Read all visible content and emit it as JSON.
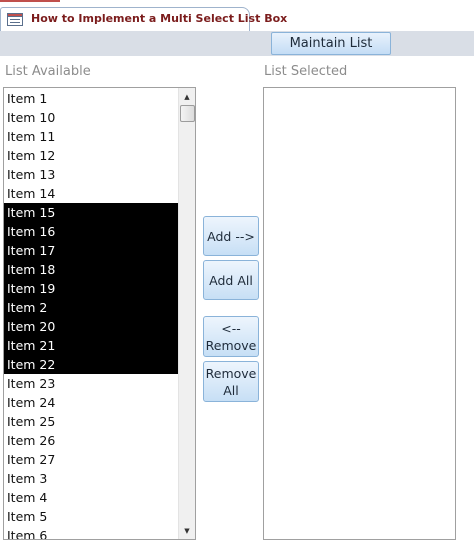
{
  "document": {
    "tab_title": "How to Implement a Multi Select List Box",
    "tab_icon": "form-icon"
  },
  "header": {
    "maintain_label": "Maintain List"
  },
  "available_list": {
    "label": "List Available",
    "items": [
      {
        "text": "Item 1",
        "selected": false
      },
      {
        "text": "Item 10",
        "selected": false
      },
      {
        "text": "Item 11",
        "selected": false
      },
      {
        "text": "Item 12",
        "selected": false
      },
      {
        "text": "Item 13",
        "selected": false
      },
      {
        "text": "Item 14",
        "selected": false
      },
      {
        "text": "Item 15",
        "selected": true
      },
      {
        "text": "Item 16",
        "selected": true
      },
      {
        "text": "Item 17",
        "selected": true
      },
      {
        "text": "Item 18",
        "selected": true
      },
      {
        "text": "Item 19",
        "selected": true
      },
      {
        "text": "Item 2",
        "selected": true
      },
      {
        "text": "Item 20",
        "selected": true
      },
      {
        "text": "Item 21",
        "selected": true
      },
      {
        "text": "Item 22",
        "selected": true
      },
      {
        "text": "Item 23",
        "selected": false
      },
      {
        "text": "Item 24",
        "selected": false
      },
      {
        "text": "Item 25",
        "selected": false
      },
      {
        "text": "Item 26",
        "selected": false
      },
      {
        "text": "Item 27",
        "selected": false
      },
      {
        "text": "Item 3",
        "selected": false
      },
      {
        "text": "Item 4",
        "selected": false
      },
      {
        "text": "Item 5",
        "selected": false
      },
      {
        "text": "Item 6",
        "selected": false
      }
    ],
    "scroll_up_glyph": "▲",
    "scroll_down_glyph": "▼"
  },
  "selected_list": {
    "label": "List Selected",
    "items": []
  },
  "actions": {
    "add_label": "Add -->",
    "add_all_label": "Add All",
    "remove_label": "<--\nRemove",
    "remove_all_label": "Remove\nAll"
  },
  "colors": {
    "tab_title": "#7b1c1c",
    "selection_bg": "#000000",
    "selection_fg": "#ffffff",
    "button_border": "#8ab3d9",
    "label_gray": "#8c8c8c"
  }
}
